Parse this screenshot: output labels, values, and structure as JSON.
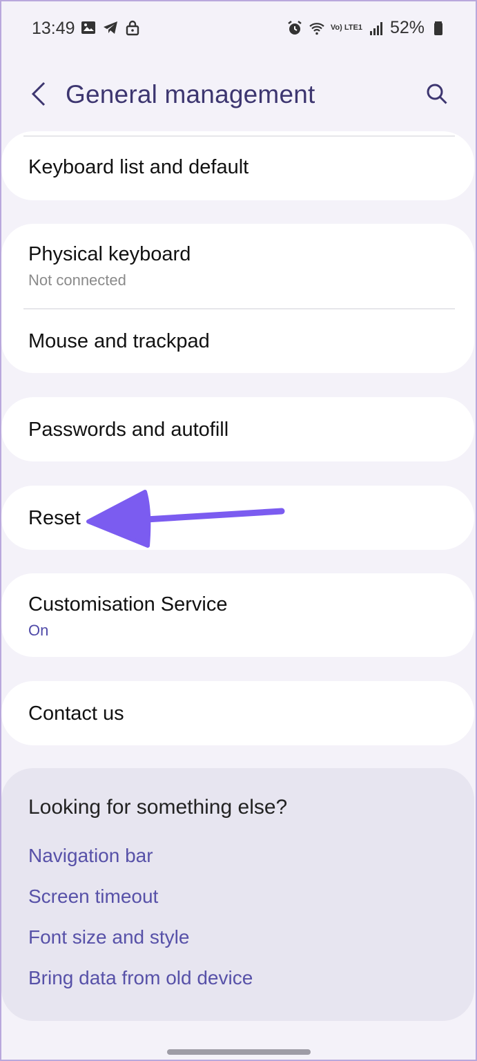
{
  "status_bar": {
    "time": "13:49",
    "network": "Vo) LTE1",
    "battery": "52%",
    "icons": [
      "image-icon",
      "telegram-icon",
      "lock-icon",
      "alarm-icon",
      "wifi-icon",
      "signal-icon",
      "battery-icon"
    ]
  },
  "header": {
    "title": "General management",
    "back_icon": "chevron-left-icon",
    "search_icon": "search-icon"
  },
  "items": {
    "keyboard_list": {
      "title": "Keyboard list and default"
    },
    "physical_keyboard": {
      "title": "Physical keyboard",
      "subtitle": "Not connected"
    },
    "mouse_trackpad": {
      "title": "Mouse and trackpad"
    },
    "passwords_autofill": {
      "title": "Passwords and autofill"
    },
    "reset": {
      "title": "Reset"
    },
    "customisation_service": {
      "title": "Customisation Service",
      "subtitle": "On"
    },
    "contact_us": {
      "title": "Contact us"
    }
  },
  "suggestions": {
    "title": "Looking for something else?",
    "links": [
      "Navigation bar",
      "Screen timeout",
      "Font size and style",
      "Bring data from old device"
    ]
  },
  "colors": {
    "background": "#f4f2f9",
    "card": "#ffffff",
    "title_accent": "#3d3670",
    "link_accent": "#5751a8",
    "annotation_arrow": "#7b5cf0"
  }
}
